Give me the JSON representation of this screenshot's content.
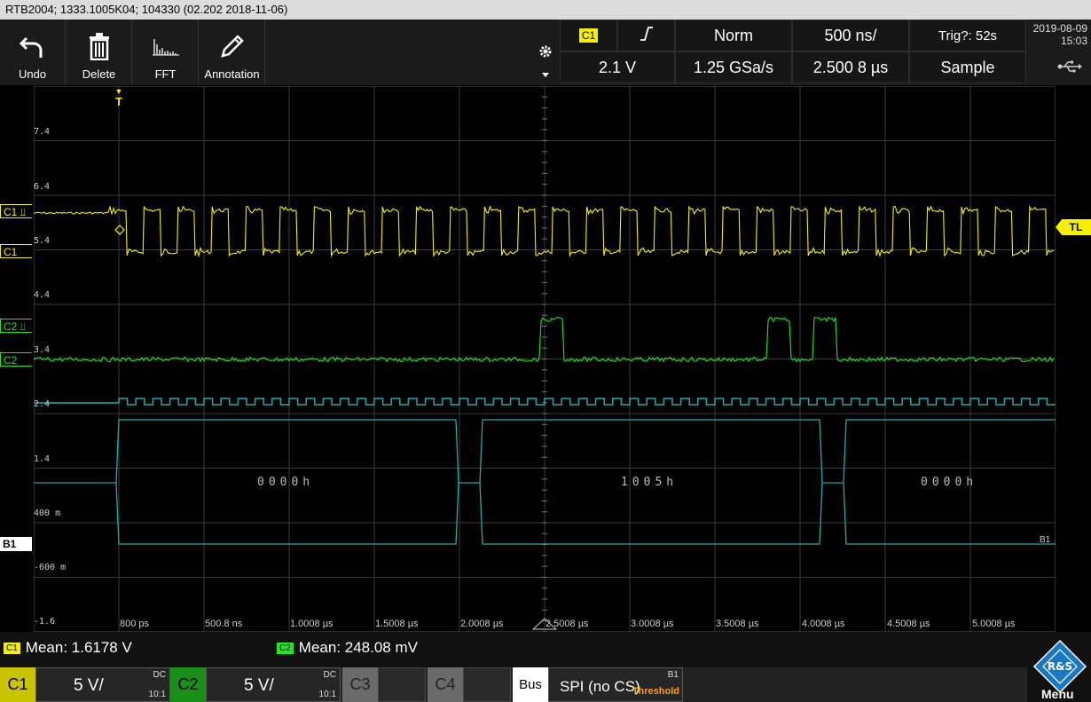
{
  "titlebar": {
    "text": "RTB2004; 1333.1005K04; 104330 (02.202 2018-11-06)"
  },
  "toolbar": {
    "undo": "Undo",
    "delete": "Delete",
    "fft": "FFT",
    "annotation": "Annotation"
  },
  "trigger": {
    "channel": "C1",
    "slope_icon": "rising-edge-icon",
    "mode": "Norm",
    "timebase": "500 ns/",
    "status": "Trig?: 52s",
    "level": "2.1 V",
    "samplerate": "1.25 GSa/s",
    "position": "2.500 8 µs",
    "acq": "Sample"
  },
  "datetime": {
    "date": "2019-08-09",
    "time": "15:03"
  },
  "yaxis": [
    "7.4",
    "6.4",
    "5.4",
    "4.4",
    "3.4",
    "2.4",
    "1.4",
    "400 m",
    "-600 m",
    "-1.6"
  ],
  "xaxis": [
    "800 ps",
    "500.8 ns",
    "1.0008 µs",
    "1.5008 µs",
    "2.0008 µs",
    "2.5008 µs",
    "3.0008 µs",
    "3.5008 µs",
    "4.0008 µs",
    "4.5008 µs",
    "5.0008 µs"
  ],
  "markers": {
    "trigger": "T",
    "tl": "TL",
    "c1a": "C1",
    "c1b": "C1",
    "c2a": "C2",
    "c2b": "C2",
    "b1": "B1",
    "b1right": "B1"
  },
  "bus": {
    "words": [
      "0000h",
      "1005h",
      "0000h"
    ]
  },
  "measure": {
    "c1_label": "C1",
    "c1_text": "Mean: 1.6178 V",
    "c2_label": "C2",
    "c2_text": "Mean: 248.08 mV"
  },
  "bottom": {
    "c1": "C1",
    "c1_scale": "5 V/",
    "c1_cpl": "DC",
    "c1_probe": "10:1",
    "c2": "C2",
    "c2_scale": "5 V/",
    "c2_cpl": "DC",
    "c2_probe": "10:1",
    "c3": "C3",
    "c4": "C4",
    "bus": "Bus",
    "bus_proto": "SPI (no CS)",
    "bus_id": "B1",
    "bus_thresh": "Threshold",
    "menu": "Menu"
  },
  "colors": {
    "c1": "#f5f000",
    "c2": "#1ee81e",
    "bus": "#2aa7a7"
  }
}
